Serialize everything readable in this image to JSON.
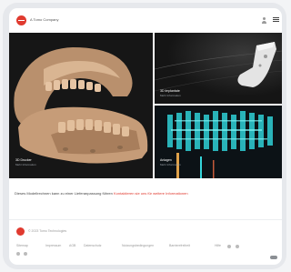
{
  "header": {
    "brand": "A Tomo Company"
  },
  "tiles": [
    {
      "caption": "3D Drucker",
      "sub": "Mehr Information"
    },
    {
      "caption": "3D Implantate",
      "sub": "Mehr Information"
    },
    {
      "caption": "Anlagen",
      "sub": "Mehr Information"
    }
  ],
  "notice": {
    "text": "Dieses Modellrechnen kann zu einer Lieferanpassung führen",
    "link": "Kontaktieren sie uns für weitere Informationen"
  },
  "footer": {
    "brand": "© 2023 Tomo Technologies",
    "links": [
      "Sitemap",
      "Impressum",
      "AGB",
      "Datenschutz",
      "Nutzungsbedingungen",
      "Barrierefreiheit",
      "Hilfe"
    ]
  },
  "colors": {
    "accent": "#e03a2f"
  }
}
